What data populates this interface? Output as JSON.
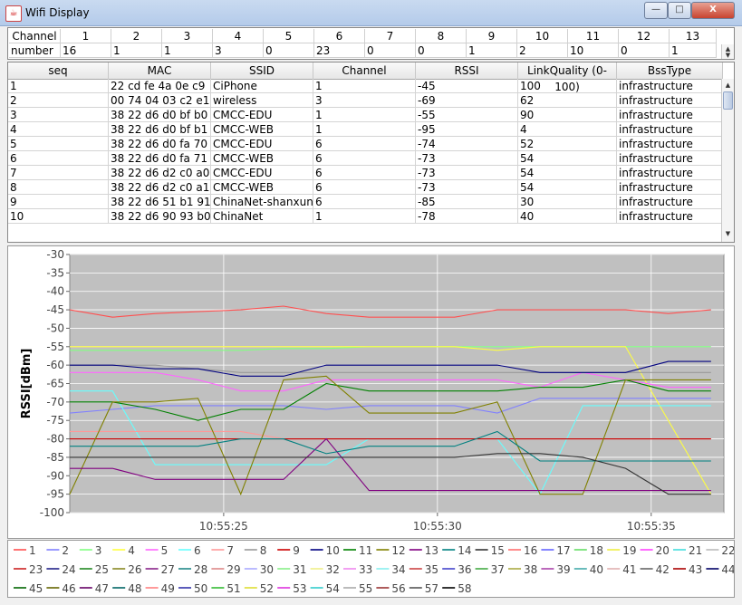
{
  "window": {
    "title": "Wifi Display",
    "min_label": "—",
    "max_label": "□",
    "close_label": "X"
  },
  "channel_table": {
    "header_label": "Channel",
    "row_label": "number",
    "channels": [
      "1",
      "2",
      "3",
      "4",
      "5",
      "6",
      "7",
      "8",
      "9",
      "10",
      "11",
      "12",
      "13"
    ],
    "counts": [
      "16",
      "1",
      "1",
      "3",
      "0",
      "23",
      "0",
      "0",
      "1",
      "2",
      "10",
      "0",
      "1"
    ]
  },
  "ap_table": {
    "columns": [
      "seq",
      "MAC",
      "SSID",
      "Channel",
      "RSSI",
      "LinkQuality (0-100)",
      "BssType"
    ],
    "rows": [
      [
        "1",
        "22 cd fe 4a 0e c9",
        "CiPhone",
        "1",
        "-45",
        "100",
        "infrastructure"
      ],
      [
        "2",
        "00 74 04 03 c2 e1",
        "wireless",
        "3",
        "-69",
        "62",
        "infrastructure"
      ],
      [
        "3",
        "38 22 d6 d0 bf b0",
        "CMCC-EDU",
        "1",
        "-55",
        "90",
        "infrastructure"
      ],
      [
        "4",
        "38 22 d6 d0 bf b1",
        "CMCC-WEB",
        "1",
        "-95",
        "4",
        "infrastructure"
      ],
      [
        "5",
        "38 22 d6 d0 fa 70",
        "CMCC-EDU",
        "6",
        "-74",
        "52",
        "infrastructure"
      ],
      [
        "6",
        "38 22 d6 d0 fa 71",
        "CMCC-WEB",
        "6",
        "-73",
        "54",
        "infrastructure"
      ],
      [
        "7",
        "38 22 d6 d2 c0 a0",
        "CMCC-EDU",
        "6",
        "-73",
        "54",
        "infrastructure"
      ],
      [
        "8",
        "38 22 d6 d2 c0 a1",
        "CMCC-WEB",
        "6",
        "-73",
        "54",
        "infrastructure"
      ],
      [
        "9",
        "38 22 d6 51 b1 91",
        "ChinaNet-shanxun",
        "6",
        "-85",
        "30",
        "infrastructure"
      ],
      [
        "10",
        "38 22 d6 90 93 b0",
        "ChinaNet",
        "1",
        "-78",
        "40",
        "infrastructure"
      ]
    ]
  },
  "chart_data": {
    "type": "line",
    "ylabel": "RSSI[dBm]",
    "ylim": [
      -100,
      -30
    ],
    "yticks": [
      "-30",
      "-35",
      "-40",
      "-45",
      "-50",
      "-55",
      "-60",
      "-65",
      "-70",
      "-75",
      "-80",
      "-85",
      "-90",
      "-95",
      "-100"
    ],
    "x": [
      0,
      1,
      2,
      3,
      4,
      5,
      6,
      7,
      8,
      9,
      10,
      11,
      12,
      13,
      14,
      15
    ],
    "xticks": [
      {
        "x": 3.6,
        "label": "10:55:25"
      },
      {
        "x": 8.6,
        "label": "10:55:30"
      },
      {
        "x": 13.6,
        "label": "10:55:35"
      }
    ],
    "series": [
      {
        "name": "1",
        "color": "#ff5050",
        "values": [
          -45,
          -47,
          -46,
          -45.5,
          -45,
          -44,
          -46,
          -47,
          -47,
          -47,
          -45,
          -45,
          -45,
          -45,
          -46,
          -45
        ]
      },
      {
        "name": "2",
        "color": "#8080ff",
        "values": [
          -73,
          -72,
          -71,
          -71,
          -71,
          -71,
          -72,
          -71,
          -71,
          -71,
          -73,
          -69,
          -69,
          -69,
          -69,
          -69
        ]
      },
      {
        "name": "3",
        "color": "#80ff80",
        "values": [
          -56,
          -56,
          -56,
          -56,
          -56,
          -55.5,
          -55.5,
          -55,
          -55,
          -55,
          -55,
          -55,
          -55,
          -55,
          -55,
          -55
        ]
      },
      {
        "name": "4",
        "color": "#ffff40",
        "values": [
          -55,
          -55,
          -55,
          -55,
          -55,
          -55,
          -55,
          -55,
          -55,
          -55,
          -56,
          -55,
          -55,
          -55,
          -75,
          -95
        ]
      },
      {
        "name": "5",
        "color": "#ff66ff",
        "values": [
          -62,
          -62,
          -62,
          -64,
          -67,
          -67,
          -64,
          -64,
          -64,
          -64,
          -64,
          -66,
          -62,
          -64,
          -66,
          -66
        ]
      },
      {
        "name": "6",
        "color": "#66ffff",
        "values": [
          -67,
          -67,
          -87,
          -87,
          -87,
          -87,
          -87,
          -80,
          -80,
          -80,
          -80,
          -95,
          -71,
          -71,
          -71,
          -71
        ]
      },
      {
        "name": "7",
        "color": "#ff9999",
        "values": [
          -78,
          -78,
          -78,
          -78,
          -78,
          -80,
          -80,
          -80,
          -80,
          -80,
          -80,
          -80,
          -80,
          -80,
          -80,
          -80
        ]
      },
      {
        "name": "8",
        "color": "#999999",
        "values": [
          -60,
          -60,
          -60,
          -61,
          -62,
          -62,
          -62,
          -62,
          -62,
          -62,
          -62,
          -62,
          -62,
          -62,
          -62,
          -62
        ]
      },
      {
        "name": "9",
        "color": "#cc0000",
        "values": [
          -80,
          -80,
          -80,
          -80,
          -80,
          -80,
          -80,
          -80,
          -80,
          -80,
          -80,
          -80,
          -80,
          -80,
          -80,
          -80
        ]
      },
      {
        "name": "10",
        "color": "#000080",
        "values": [
          -60,
          -60,
          -61,
          -61,
          -63,
          -63,
          -60,
          -60,
          -60,
          -60,
          -60,
          -62,
          -62,
          -62,
          -59,
          -59
        ]
      },
      {
        "name": "11",
        "color": "#008000",
        "values": [
          -70,
          -70,
          -72,
          -75,
          -72,
          -72,
          -65,
          -67,
          -67,
          -67,
          -67,
          -66,
          -66,
          -64,
          -67,
          -67
        ]
      },
      {
        "name": "12",
        "color": "#808000",
        "values": [
          -95,
          -70,
          -70,
          -69,
          -95,
          -64,
          -63,
          -73,
          -73,
          -73,
          -70,
          -95,
          -95,
          -64,
          -64,
          -64
        ]
      },
      {
        "name": "13",
        "color": "#800080",
        "values": [
          -88,
          -88,
          -91,
          -91,
          -91,
          -91,
          -80,
          -94,
          -94,
          -94,
          -94,
          -94,
          -94,
          -94,
          -94,
          -94
        ]
      },
      {
        "name": "14",
        "color": "#008080",
        "values": [
          -82,
          -82,
          -82,
          -82,
          -80,
          -80,
          -84,
          -82,
          -82,
          -82,
          -78,
          -86,
          -86,
          -86,
          -86,
          -86
        ]
      },
      {
        "name": "15",
        "color": "#333333",
        "values": [
          -85,
          -85,
          -85,
          -85,
          -85,
          -85,
          -85,
          -85,
          -85,
          -85,
          -84,
          -84,
          -85,
          -88,
          -95,
          -95
        ]
      }
    ],
    "legend": [
      "1",
      "2",
      "3",
      "4",
      "5",
      "6",
      "7",
      "8",
      "9",
      "10",
      "11",
      "12",
      "13",
      "14",
      "15",
      "16",
      "17",
      "18",
      "19",
      "20",
      "21",
      "22",
      "23",
      "24",
      "25",
      "26",
      "27",
      "28",
      "29",
      "30",
      "31",
      "32",
      "33",
      "34",
      "35",
      "36",
      "37",
      "38",
      "39",
      "40",
      "41",
      "42",
      "43",
      "44",
      "45",
      "46",
      "47",
      "48",
      "49",
      "50",
      "51",
      "52",
      "53",
      "54",
      "55",
      "56",
      "57",
      "58"
    ],
    "legend_colors": [
      "#ff5050",
      "#8080ff",
      "#80ff80",
      "#ffff40",
      "#ff66ff",
      "#66ffff",
      "#ff9999",
      "#999999",
      "#cc0000",
      "#000080",
      "#008000",
      "#808000",
      "#800080",
      "#008080",
      "#333333",
      "#ff7070",
      "#6666ff",
      "#66dd66",
      "#eeee44",
      "#ff44ff",
      "#44dddd",
      "#bbbbbb",
      "#cc2222",
      "#222288",
      "#228822",
      "#888822",
      "#882288",
      "#228888",
      "#dd8888",
      "#aaaaff",
      "#88ee88",
      "#eeee88",
      "#ee88ee",
      "#88eeee",
      "#cc4444",
      "#4444cc",
      "#44aa44",
      "#aaaa44",
      "#aa44aa",
      "#44aaaa",
      "#e0b0b0",
      "#666666",
      "#aa0000",
      "#000066",
      "#006600",
      "#666600",
      "#660066",
      "#006666",
      "#ff8080",
      "#3333aa",
      "#33bb33",
      "#dddd33",
      "#dd33dd",
      "#33cccc",
      "#aaaaaa",
      "#993333",
      "#555555",
      "#000000"
    ]
  }
}
